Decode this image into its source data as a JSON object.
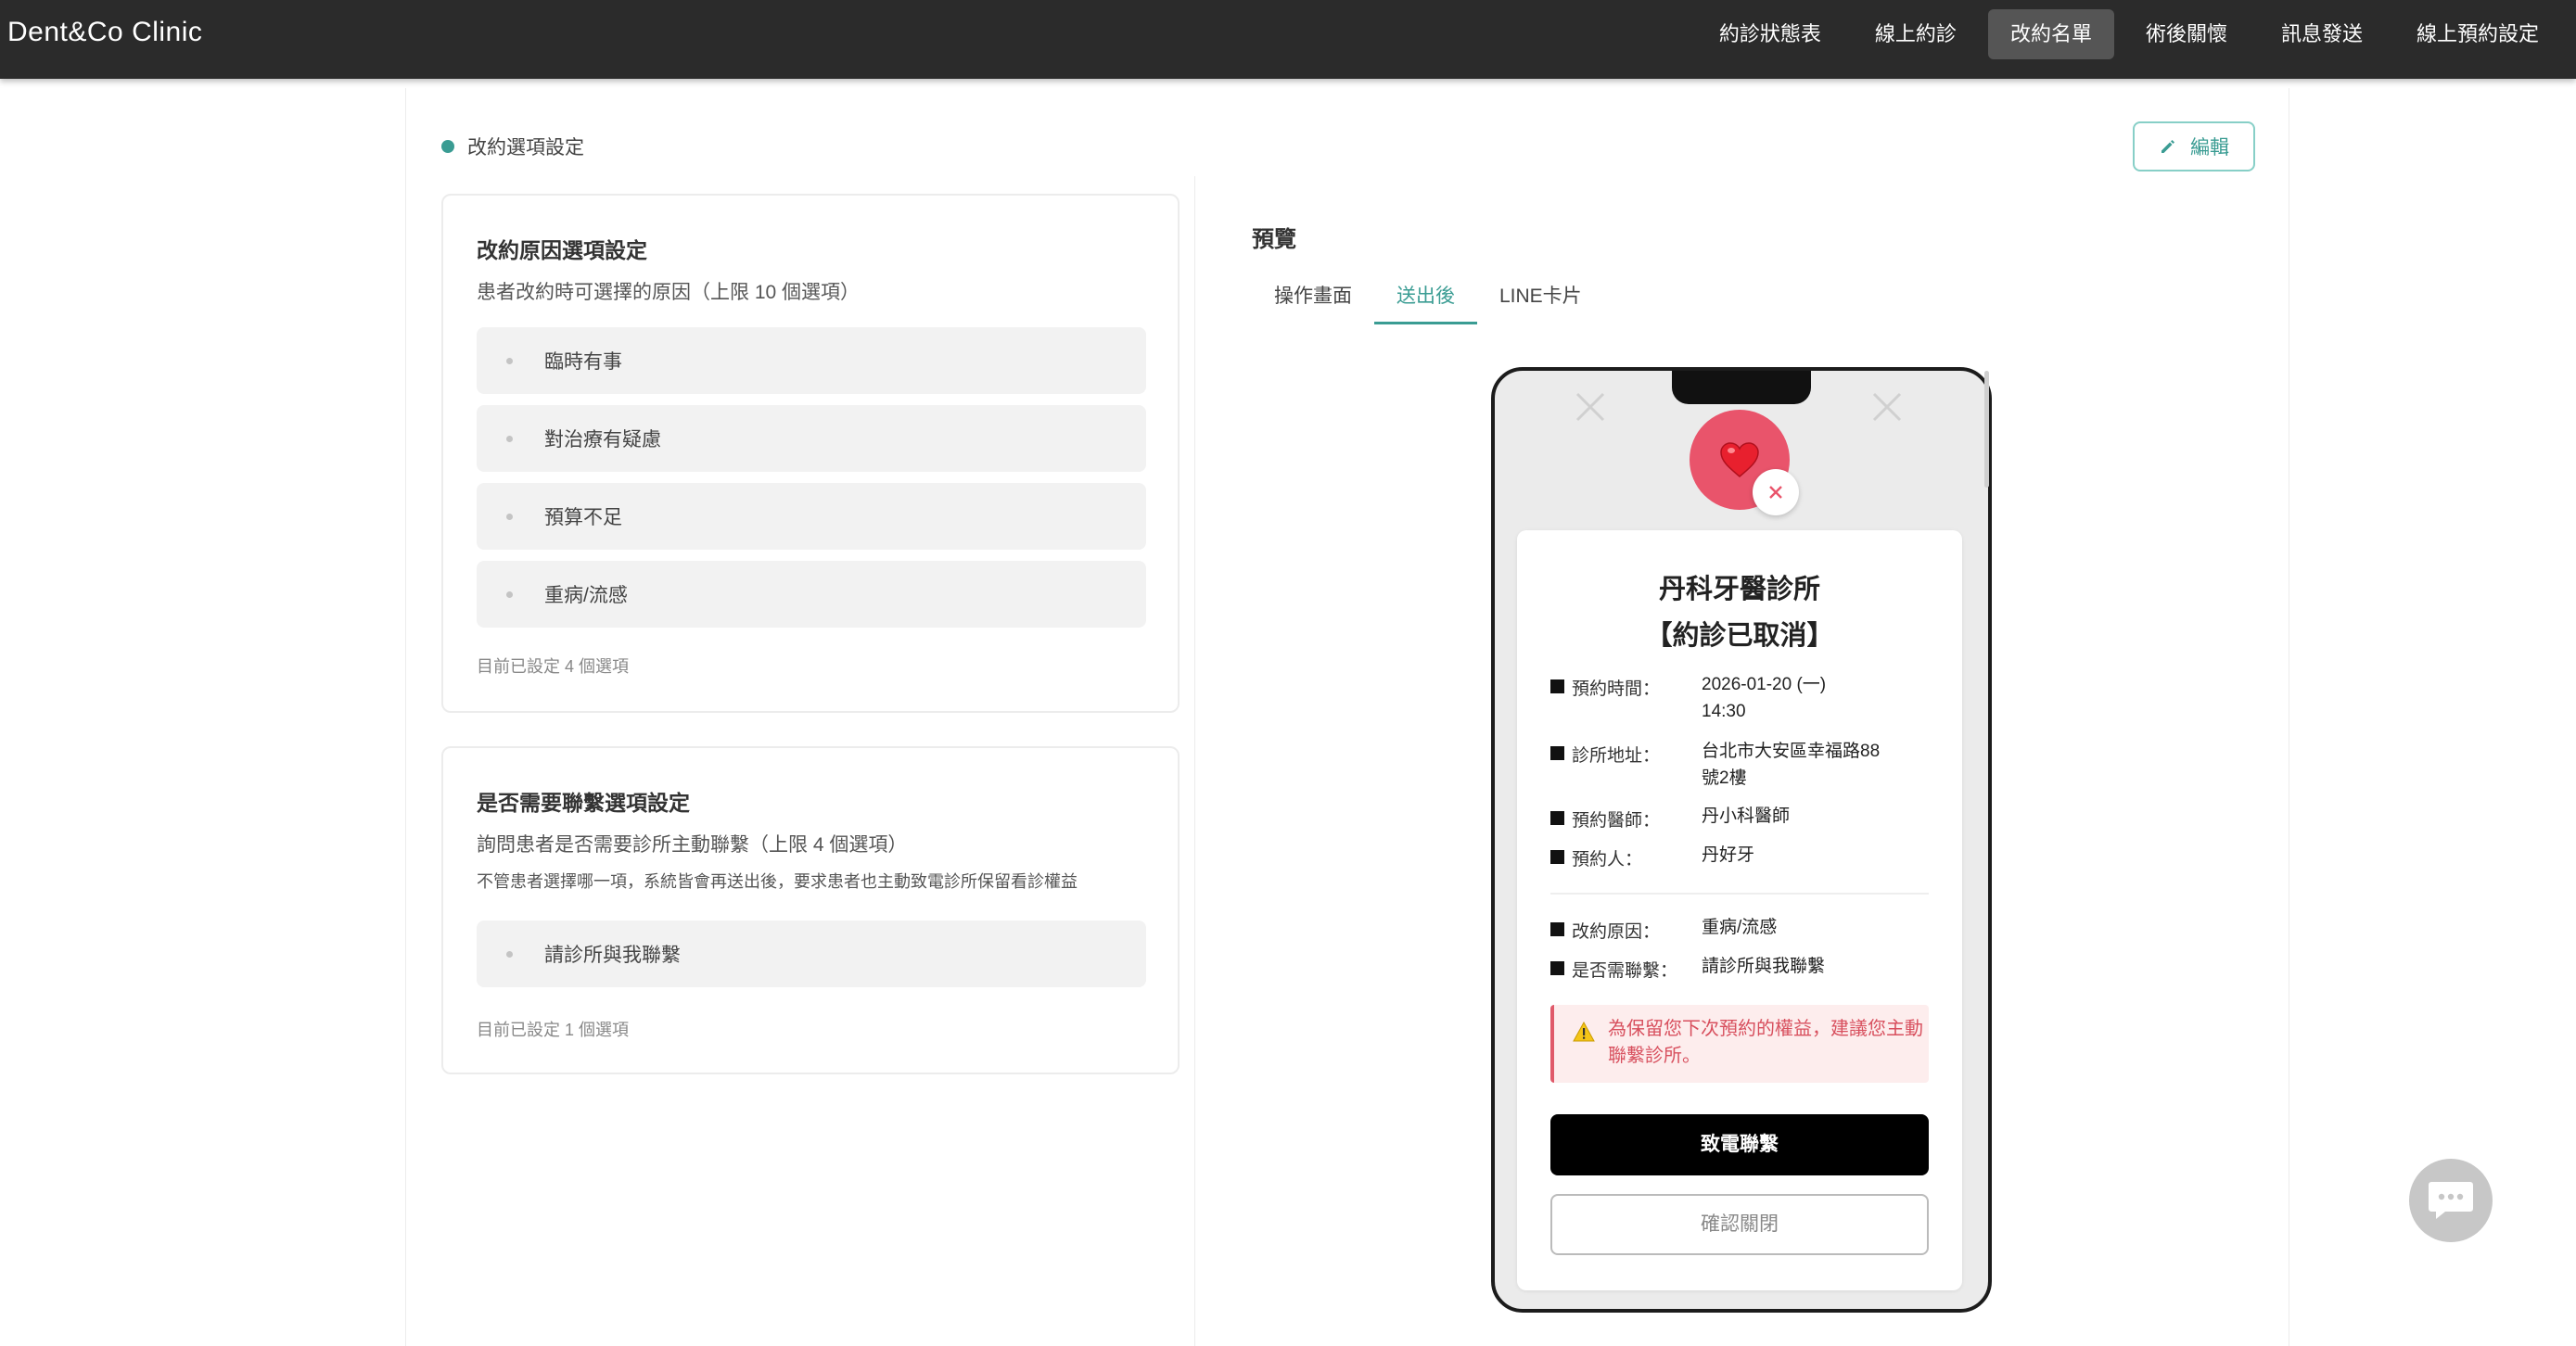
{
  "brand": "Dent&Co Clinic",
  "nav": [
    {
      "label": "約診狀態表"
    },
    {
      "label": "線上約診"
    },
    {
      "label": "改約名單",
      "active": true
    },
    {
      "label": "術後關懷"
    },
    {
      "label": "訊息發送"
    },
    {
      "label": "線上預約設定"
    }
  ],
  "section": {
    "title": "改約選項設定",
    "edit_label": "編輯",
    "accent_color": "#3a9c93"
  },
  "reasons_card": {
    "title": "改約原因選項設定",
    "subtitle": "患者改約時可選擇的原因（上限 10 個選項）",
    "options": [
      "臨時有事",
      "對治療有疑慮",
      "預算不足",
      "重病/流感"
    ],
    "count_text": "目前已設定 4 個選項"
  },
  "contact_card": {
    "title": "是否需要聯繫選項設定",
    "subtitle": "詢問患者是否需要診所主動聯繫（上限 4 個選項）",
    "note": "不管患者選擇哪一項，系統皆會再送出後，要求患者也主動致電診所保留看診權益",
    "options": [
      "請診所與我聯繫"
    ],
    "count_text": "目前已設定 1 個選項"
  },
  "preview": {
    "title": "預覽",
    "tabs": [
      {
        "label": "操作畫面"
      },
      {
        "label": "送出後",
        "active": true
      },
      {
        "label": "LINE卡片"
      }
    ],
    "phone": {
      "clinic_name": "丹科牙醫診所",
      "status_title": "【約診已取消】",
      "rows": [
        {
          "key": "預約時間：",
          "value": "2026-01-20 (一) 14:30"
        },
        {
          "key": "診所地址：",
          "value": "台北市大安區幸福路88號2樓"
        },
        {
          "key": "預約醫師：",
          "value": "丹小科醫師"
        },
        {
          "key": "預約人：",
          "value": "丹好牙"
        }
      ],
      "rows2": [
        {
          "key": "改約原因：",
          "value": "重病/流感"
        },
        {
          "key": "是否需聯繫：",
          "value": "請診所與我聯繫"
        }
      ],
      "warning": "為保留您下次預約的權益，建議您主動聯繫診所。",
      "call_button": "致電聯繫",
      "close_button": "確認關閉"
    }
  }
}
